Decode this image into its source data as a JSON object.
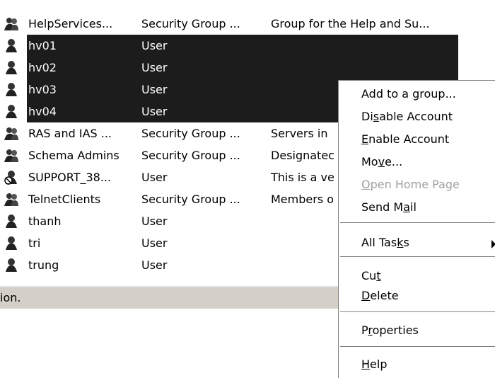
{
  "rows": [
    {
      "name": "HelpServices...",
      "type": "Security Group ...",
      "desc": "Group for the Help and Su...",
      "icon": "group-icon"
    },
    {
      "name": "hv01",
      "type": "User",
      "desc": "",
      "icon": "user-icon"
    },
    {
      "name": "hv02",
      "type": "User",
      "desc": "",
      "icon": "user-icon"
    },
    {
      "name": "hv03",
      "type": "User",
      "desc": "",
      "icon": "user-icon"
    },
    {
      "name": "hv04",
      "type": "User",
      "desc": "",
      "icon": "user-icon"
    },
    {
      "name": "RAS and IAS ...",
      "type": "Security Group ...",
      "desc": "Servers in",
      "icon": "group-icon"
    },
    {
      "name": "Schema Admins",
      "type": "Security Group ...",
      "desc": "Designatec",
      "icon": "group-icon"
    },
    {
      "name": "SUPPORT_38...",
      "type": "User",
      "desc": "This is a ve",
      "icon": "user-disabled-icon"
    },
    {
      "name": "TelnetClients",
      "type": "Security Group ...",
      "desc": "Members o",
      "icon": "group-icon"
    },
    {
      "name": "thanh",
      "type": "User",
      "desc": "",
      "icon": "user-icon"
    },
    {
      "name": "tri",
      "type": "User",
      "desc": "",
      "icon": "user-icon"
    },
    {
      "name": "trung",
      "type": "User",
      "desc": "",
      "icon": "user-icon"
    }
  ],
  "status": {
    "text": "ion."
  },
  "menu": {
    "add_to_group": {
      "pre": "Add to a ",
      "key": "g",
      "post": "roup..."
    },
    "disable_account": {
      "pre": "Di",
      "key": "s",
      "post": "able Account"
    },
    "enable_account": {
      "pre": "",
      "key": "E",
      "post": "nable Account"
    },
    "move": {
      "pre": "Mo",
      "key": "v",
      "post": "e..."
    },
    "open_home_page": {
      "pre": "",
      "key": "O",
      "post": "pen Home Page"
    },
    "send_mail": {
      "pre": "Send M",
      "key": "a",
      "post": "il"
    },
    "all_tasks": {
      "pre": "All Tas",
      "key": "k",
      "post": "s"
    },
    "cut": {
      "pre": "Cu",
      "key": "t",
      "post": ""
    },
    "delete": {
      "pre": "",
      "key": "D",
      "post": "elete"
    },
    "properties": {
      "pre": "P",
      "key": "r",
      "post": "operties"
    },
    "help": {
      "pre": "",
      "key": "H",
      "post": "elp"
    }
  }
}
